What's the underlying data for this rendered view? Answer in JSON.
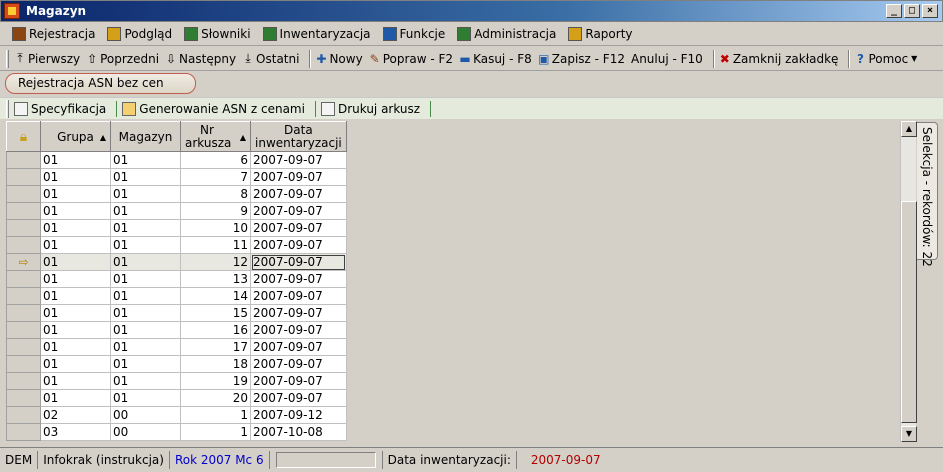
{
  "window": {
    "title": "Magazyn",
    "minimize": "_",
    "maximize": "□",
    "close": "×"
  },
  "menu": [
    {
      "label": "Rejestracja",
      "icon": "pencil-icon",
      "color": "#8b4513"
    },
    {
      "label": "Podgląd",
      "icon": "folder-icon",
      "color": "#d4a017"
    },
    {
      "label": "Słowniki",
      "icon": "book-icon",
      "color": "#2e7d32"
    },
    {
      "label": "Inwentaryzacja",
      "icon": "chart-icon",
      "color": "#2e7d32"
    },
    {
      "label": "Funkcje",
      "icon": "gear-window-icon",
      "color": "#1e5aa8"
    },
    {
      "label": "Administracja",
      "icon": "books-icon",
      "color": "#2e7d32"
    },
    {
      "label": "Raporty",
      "icon": "report-icon",
      "color": "#d4a017"
    }
  ],
  "toolbar": {
    "first": "Pierwszy",
    "prev": "Poprzedni",
    "next": "Następny",
    "last": "Ostatni",
    "new": "Nowy",
    "edit": "Popraw - F2",
    "delete": "Kasuj - F8",
    "save": "Zapisz - F12",
    "cancel": "Anuluj - F10",
    "close_tab": "Zamknij zakładkę",
    "help": "Pomoc"
  },
  "tab": {
    "label": "Rejestracja ASN bez cen"
  },
  "subtoolbar": {
    "spec": "Specyfikacja",
    "generate": "Generowanie ASN z cenami",
    "print": "Drukuj arkusz"
  },
  "grid": {
    "columns": [
      "Grupa",
      "Magazyn",
      "Nr arkusza",
      "Data inwentaryzacji"
    ],
    "current_row": 6,
    "rows": [
      [
        "01",
        "01",
        "6",
        "2007-09-07"
      ],
      [
        "01",
        "01",
        "7",
        "2007-09-07"
      ],
      [
        "01",
        "01",
        "8",
        "2007-09-07"
      ],
      [
        "01",
        "01",
        "9",
        "2007-09-07"
      ],
      [
        "01",
        "01",
        "10",
        "2007-09-07"
      ],
      [
        "01",
        "01",
        "11",
        "2007-09-07"
      ],
      [
        "01",
        "01",
        "12",
        "2007-09-07"
      ],
      [
        "01",
        "01",
        "13",
        "2007-09-07"
      ],
      [
        "01",
        "01",
        "14",
        "2007-09-07"
      ],
      [
        "01",
        "01",
        "15",
        "2007-09-07"
      ],
      [
        "01",
        "01",
        "16",
        "2007-09-07"
      ],
      [
        "01",
        "01",
        "17",
        "2007-09-07"
      ],
      [
        "01",
        "01",
        "18",
        "2007-09-07"
      ],
      [
        "01",
        "01",
        "19",
        "2007-09-07"
      ],
      [
        "01",
        "01",
        "20",
        "2007-09-07"
      ],
      [
        "02",
        "00",
        "1",
        "2007-09-12"
      ],
      [
        "03",
        "00",
        "1",
        "2007-10-08"
      ]
    ]
  },
  "sidetab": {
    "label": "Selekcja - rekordów: 22"
  },
  "status": {
    "company": "DEM",
    "user": "Infokrak (instrukcja)",
    "period": "Rok 2007  Mc 6",
    "inv_label": "Data inwentaryzacji:",
    "inv_date": "2007-09-07"
  }
}
